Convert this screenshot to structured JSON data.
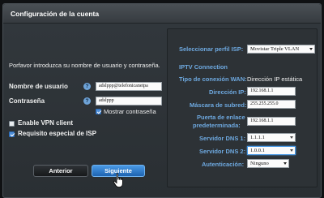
{
  "window": {
    "title": "Configuración de la cuenta"
  },
  "left": {
    "intro": "Porfavor introduzca su nombre de usuario y contraseña.",
    "username": {
      "label": "Nombre de usuario",
      "value": "adslppp@telefonicanetpa"
    },
    "password": {
      "label": "Contraseña",
      "value": "adslppp"
    },
    "show_password": {
      "label": "Mostrar contraseña",
      "checked": true
    },
    "enable_vpn": {
      "label": "Enable VPN client",
      "checked": false
    },
    "isp_requirement": {
      "label": "Requisito especial de ISP",
      "checked": true
    },
    "buttons": {
      "previous": "Anterior",
      "next": "Siguiente"
    }
  },
  "right": {
    "isp_profile": {
      "label": "Seleccionar perfil ISP:",
      "value": "Movistar Triple VLAN"
    },
    "iptv_heading": "IPTV Connection",
    "wan_type": {
      "label": "Tipo de conexión WAN:",
      "value": "Dirección IP estática"
    },
    "ip": {
      "label": "Dirección IP:",
      "value": "192.168.1.1"
    },
    "subnet": {
      "label": "Máscara de subred:",
      "value": "255.255.255.0"
    },
    "gateway": {
      "label_line1": "Puerta de enlace",
      "label_line2": "predeterminada:",
      "value": "192.168.1.1"
    },
    "dns1": {
      "label": "Servidor DNS 1:",
      "value": "1.1.1.1"
    },
    "dns2": {
      "label": "Servidor DNS 2:",
      "value": "1.0.0.1"
    },
    "auth": {
      "label": "Autenticación:",
      "value": "Ninguno"
    }
  },
  "icons": {
    "help": "question-icon",
    "cursor": "hand-pointer-icon"
  }
}
